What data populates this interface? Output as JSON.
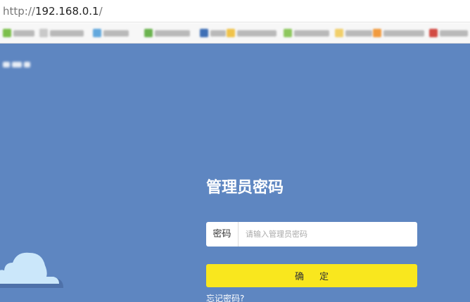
{
  "browser": {
    "url_scheme": "http://",
    "url_host": "192.168.0.1",
    "url_path": "/",
    "bookmarks": [
      {
        "icon": "green-favicon-icon",
        "color": "#7bbf4a"
      },
      {
        "icon": "page-favicon-icon",
        "color": "#c9c9c9"
      },
      {
        "icon": "blue-favicon-icon",
        "color": "#62a8dd"
      },
      {
        "icon": "green-favicon-icon",
        "color": "#6bb34f"
      },
      {
        "icon": "blue-favicon-icon",
        "color": "#3f6fb5"
      },
      {
        "icon": "yellow-favicon-icon",
        "color": "#f0c34a"
      },
      {
        "icon": "green-favicon-icon",
        "color": "#8dc75d"
      },
      {
        "icon": "folder-favicon-icon",
        "color": "#f1cf6a"
      },
      {
        "icon": "orange-favicon-icon",
        "color": "#f19a3e"
      },
      {
        "icon": "red-favicon-icon",
        "color": "#d24a43"
      }
    ]
  },
  "login": {
    "title": "管理员密码",
    "password_label": "密码",
    "password_placeholder": "请输入管理员密码",
    "confirm_label": "确定",
    "forgot_label": "忘记密码?"
  },
  "colors": {
    "background": "#5e86c1",
    "button": "#f9e71e",
    "cloud": "#cbe7fa",
    "cloud_shadow": "#4e71a9"
  }
}
